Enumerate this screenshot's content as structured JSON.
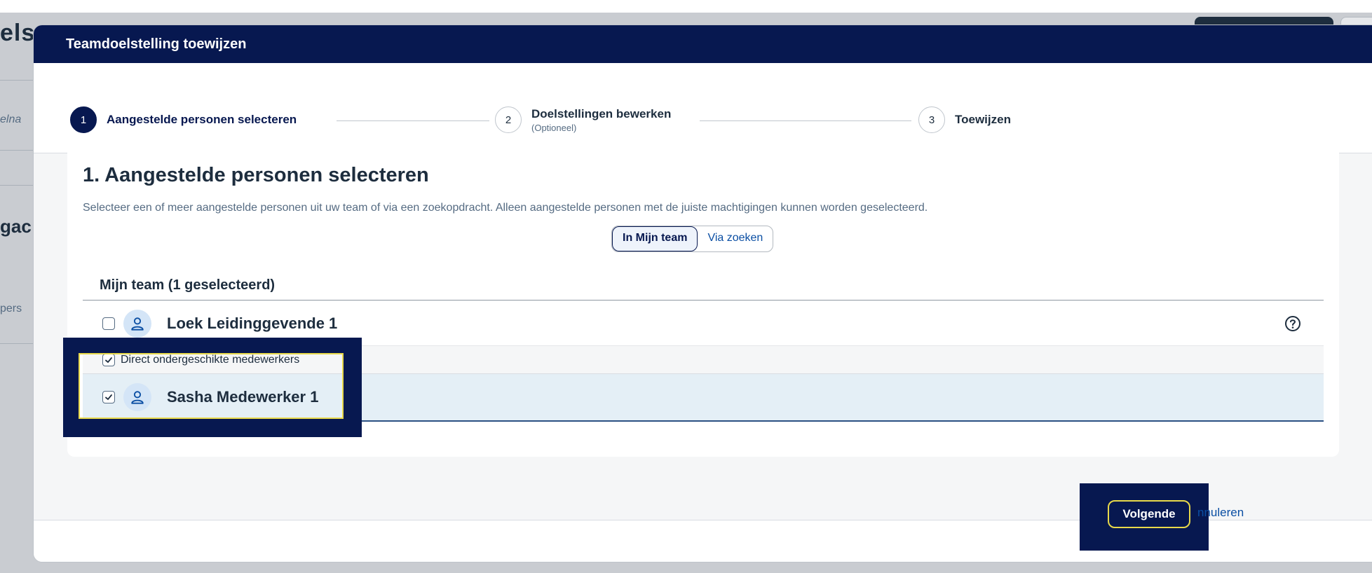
{
  "background": {
    "title_fragment": "els",
    "title_fragment_2": "",
    "side_fragment_1": "elna",
    "side_fragment_2": "gac",
    "side_fragment_3": "pers"
  },
  "modal": {
    "title": "Teamdoelstelling toewijzen",
    "steps": [
      {
        "number": "1",
        "label": "Aangestelde personen selecteren",
        "sublabel": ""
      },
      {
        "number": "2",
        "label": "Doelstellingen bewerken",
        "sublabel": "(Optioneel)"
      },
      {
        "number": "3",
        "label": "Toewijzen",
        "sublabel": ""
      }
    ],
    "section_title": "1. Aangestelde personen selecteren",
    "section_description": "Selecteer een of meer aangestelde personen uit uw team of via een zoekopdracht. Alleen aangestelde personen met de juiste machtigingen kunnen worden geselecteerd.",
    "segmented": {
      "options": [
        "In Mijn team",
        "Via zoeken"
      ],
      "selected": "In Mijn team"
    },
    "group_title": "Mijn team (1 geselecteerd)",
    "rows": [
      {
        "name": "Loek Leidinggevende 1",
        "checked": false
      },
      {
        "name": "Sasha Medewerker 1",
        "checked": true
      }
    ],
    "sub_option": {
      "label": "Direct ondergeschikte medewerkers",
      "checked": true
    },
    "footer": {
      "primary_label": "Volgende",
      "cancel_label": "nnuleren"
    }
  },
  "colors": {
    "header_bg": "#071850",
    "selected_row_bg": "#e4eff6",
    "link": "#0a4ea3",
    "highlight_outline": "#e8d94a"
  }
}
